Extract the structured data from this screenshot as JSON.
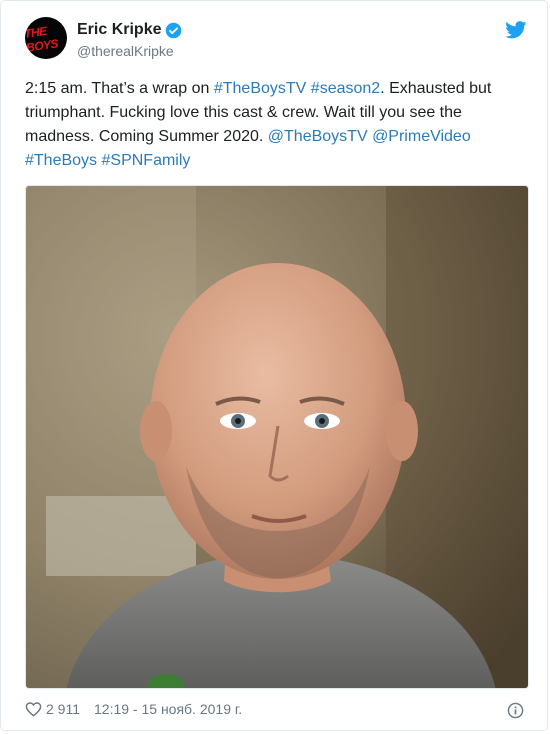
{
  "author": {
    "avatar_text": "THE BOYS",
    "display_name": "Eric Kripke",
    "handle": "@therealKripke",
    "verified_icon": "verified-badge-icon"
  },
  "tweet": {
    "segments": [
      {
        "text": "2:15 am. That’s a wrap on ",
        "link": false
      },
      {
        "text": "#TheBoysTV",
        "link": true
      },
      {
        "text": " ",
        "link": false
      },
      {
        "text": "#season2",
        "link": true
      },
      {
        "text": ". Exhausted but triumphant. Fucking love this cast & crew. Wait till you see the madness. Coming Summer 2020. ",
        "link": false
      },
      {
        "text": "@TheBoysTV",
        "link": true
      },
      {
        "text": " ",
        "link": false
      },
      {
        "text": "@PrimeVideo",
        "link": true
      },
      {
        "text": " ",
        "link": false
      },
      {
        "text": "#TheBoys",
        "link": true
      },
      {
        "text": " ",
        "link": false
      },
      {
        "text": "#SPNFamily",
        "link": true
      }
    ]
  },
  "footer": {
    "likes": "2 911",
    "timestamp": "12:19 - 15 нояб. 2019 г."
  },
  "colors": {
    "link": "#2b7bb9",
    "twitter_blue": "#1da1f2",
    "muted": "#697882"
  },
  "icons": [
    "twitter-bird-icon",
    "heart-icon",
    "info-icon",
    "verified-badge-icon"
  ]
}
